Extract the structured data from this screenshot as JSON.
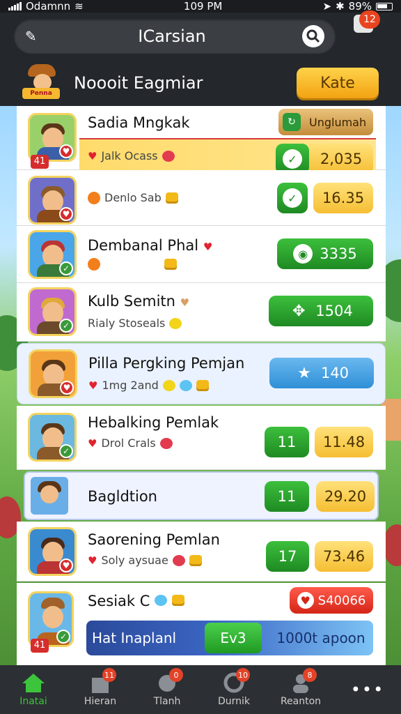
{
  "status": {
    "carrier": "Odamnn",
    "time": "109 PM",
    "battery": "89%"
  },
  "top": {
    "title": "ICarsian",
    "notification_count": "12"
  },
  "header": {
    "mascot_label": "Penna",
    "title": "Noooit Eagmiar",
    "rate_label": "Kate"
  },
  "rows": [
    {
      "rank": "41",
      "name": "Sadia Mngkak",
      "tab_label": "Unglumah",
      "sub": "Jalk Ocass",
      "value": "2,035"
    },
    {
      "sub": "Denlo Sab",
      "value": "16.35"
    },
    {
      "name": "Dembanal Phal",
      "value": "3335"
    },
    {
      "name": "Kulb Semitn",
      "sub": "Rialy Stoseals",
      "value": "1504"
    },
    {
      "name": "Pilla Pergking Pemjan",
      "sub": "1mg 2and",
      "value": "140"
    },
    {
      "name": "Hebalking Pemlak",
      "sub": "Drol Crals",
      "badge": "11",
      "value": "11.48"
    },
    {
      "name": "Bagldtion",
      "badge": "11",
      "value": "29.20"
    },
    {
      "name": "Saorening Pemlan",
      "sub": "Soly aysuae",
      "badge": "17",
      "value": "73.46"
    },
    {
      "rank": "41",
      "name": "Sesiak C",
      "value": "S40066",
      "banner_label": "Hat Inaplanl",
      "banner_badge": "Ev3",
      "banner_value": "1000t apoon"
    }
  ],
  "nav": [
    {
      "label": "Inatai"
    },
    {
      "label": "Hieran",
      "badge": "11"
    },
    {
      "label": "Tlanh",
      "badge": "0"
    },
    {
      "label": "Durnik",
      "badge": "10"
    },
    {
      "label": "Reanton",
      "badge": "8"
    }
  ],
  "colors": {
    "accent_green": "#1f8a23",
    "accent_yellow": "#f5be33",
    "accent_red": "#d42517",
    "header_bg": "#24272b"
  }
}
